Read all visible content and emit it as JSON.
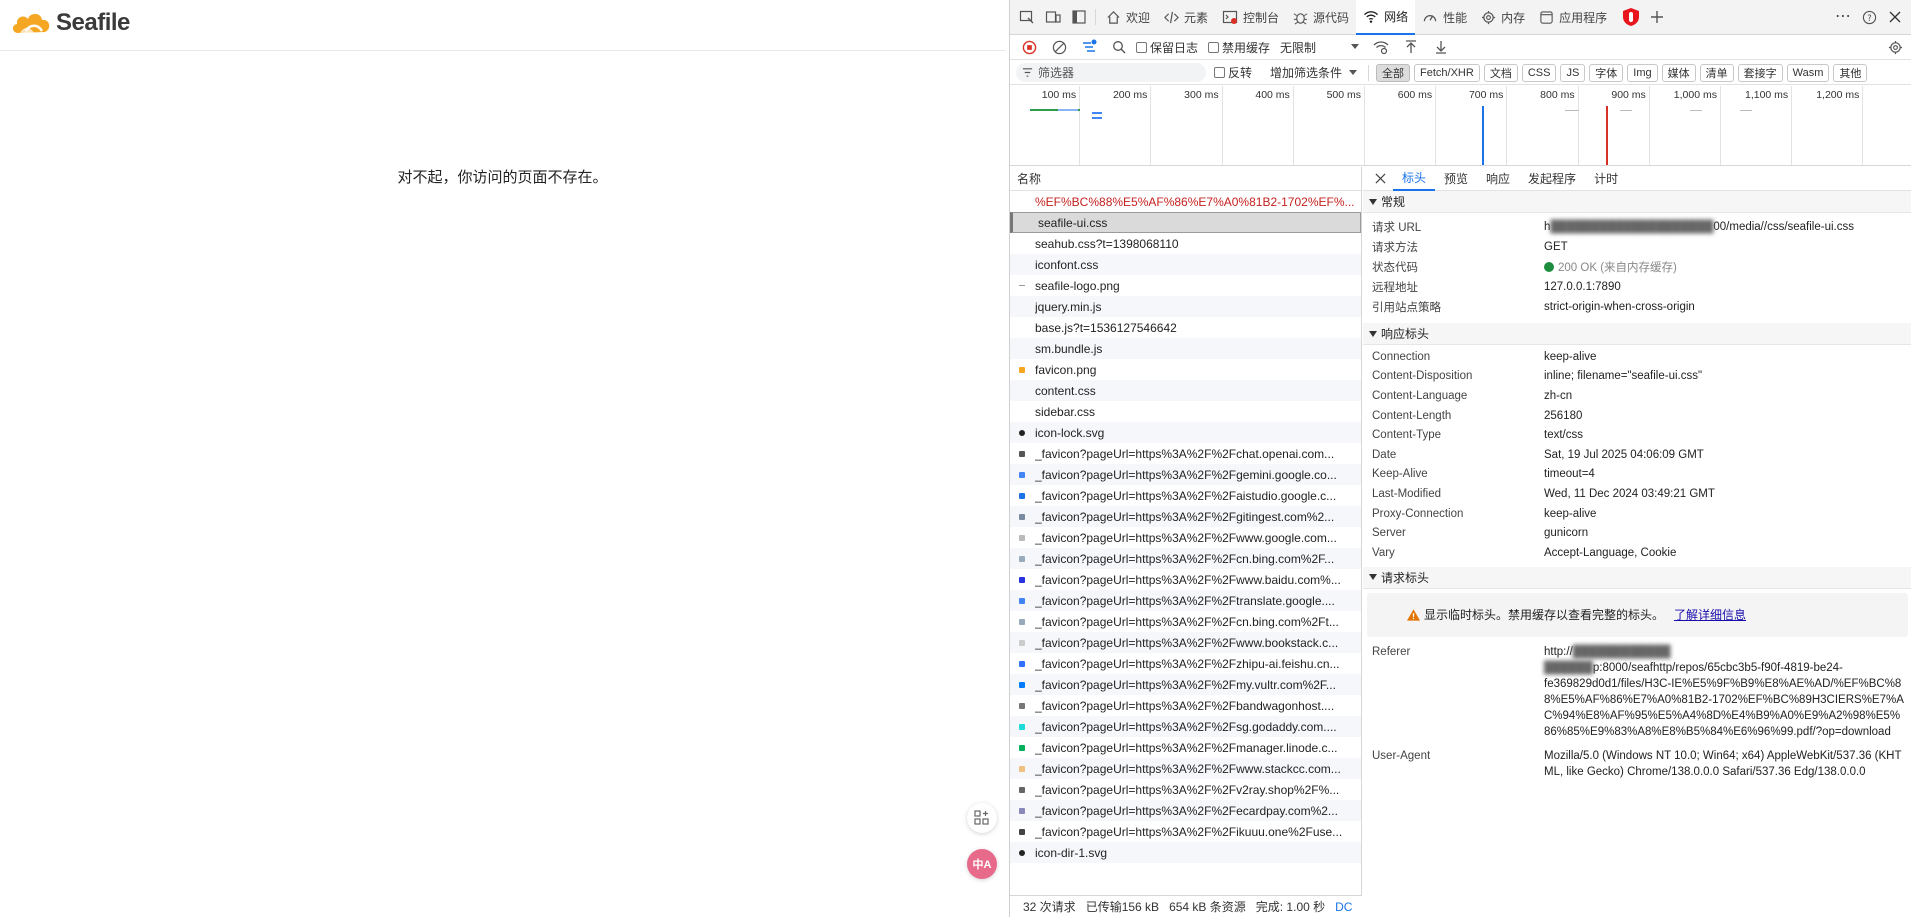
{
  "page": {
    "logo_text_prefix": "Sea",
    "logo_text_suffix": "file",
    "not_found_message": "对不起，你访问的页面不存在。"
  },
  "devtools": {
    "tabs": [
      {
        "label": "欢迎",
        "icon": "home-icon"
      },
      {
        "label": "元素",
        "icon": "code-icon"
      },
      {
        "label": "控制台",
        "icon": "console-icon"
      },
      {
        "label": "源代码",
        "icon": "bug-icon"
      },
      {
        "label": "网络",
        "icon": "wifi-icon",
        "active": true
      },
      {
        "label": "性能",
        "icon": "gauge-icon"
      },
      {
        "label": "内存",
        "icon": "gear-icon"
      },
      {
        "label": "应用程序",
        "icon": "app-icon"
      }
    ],
    "toolbar": {
      "preserve_log": "保留日志",
      "disable_cache": "禁用缓存",
      "throttling": "无限制"
    },
    "filterbar": {
      "filter_placeholder": "筛选器",
      "invert": "反转",
      "more_filters": "增加筛选条件",
      "types": [
        "全部",
        "Fetch/XHR",
        "文档",
        "CSS",
        "JS",
        "字体",
        "Img",
        "媒体",
        "清单",
        "套接字",
        "Wasm",
        "其他"
      ],
      "active_type": "全部"
    },
    "overview": {
      "tick_labels": [
        "100 ms",
        "200 ms",
        "300 ms",
        "400 ms",
        "500 ms",
        "600 ms",
        "700 ms",
        "800 ms",
        "900 ms",
        "1,000 ms",
        "1,100 ms",
        "1,200 ms",
        "1,3"
      ]
    },
    "requests": {
      "header": "名称",
      "rows": [
        {
          "name": "%EF%BC%88%E5%AF%86%E7%A0%81B2-1702%EF%...",
          "icon": "none",
          "error": true
        },
        {
          "name": "seafile-ui.css",
          "icon": "none",
          "selected": true
        },
        {
          "name": "seahub.css?t=1398068110",
          "icon": "none"
        },
        {
          "name": "iconfont.css",
          "icon": "none"
        },
        {
          "name": "seafile-logo.png",
          "icon": "dash-icon"
        },
        {
          "name": "jquery.min.js",
          "icon": "none"
        },
        {
          "name": "base.js?t=1536127546642",
          "icon": "none"
        },
        {
          "name": "sm.bundle.js",
          "icon": "none"
        },
        {
          "name": "favicon.png",
          "icon": "seafile-favicon-icon"
        },
        {
          "name": "content.css",
          "icon": "none"
        },
        {
          "name": "sidebar.css",
          "icon": "none"
        },
        {
          "name": "icon-lock.svg",
          "icon": "lock-icon"
        },
        {
          "name": "_favicon?pageUrl=https%3A%2F%2Fchat.openai.com...",
          "icon": "openai-favicon-icon"
        },
        {
          "name": "_favicon?pageUrl=https%3A%2F%2Fgemini.google.co...",
          "icon": "gemini-favicon-icon"
        },
        {
          "name": "_favicon?pageUrl=https%3A%2F%2Faistudio.google.c...",
          "icon": "aistudio-favicon-icon"
        },
        {
          "name": "_favicon?pageUrl=https%3A%2F%2Fgitingest.com%2...",
          "icon": "gitingest-favicon-icon"
        },
        {
          "name": "_favicon?pageUrl=https%3A%2F%2Fwww.google.com...",
          "icon": "google-favicon-icon"
        },
        {
          "name": "_favicon?pageUrl=https%3A%2F%2Fcn.bing.com%2F...",
          "icon": "bing-favicon-icon"
        },
        {
          "name": "_favicon?pageUrl=https%3A%2F%2Fwww.baidu.com%...",
          "icon": "baidu-favicon-icon"
        },
        {
          "name": "_favicon?pageUrl=https%3A%2F%2Ftranslate.google....",
          "icon": "translate-favicon-icon"
        },
        {
          "name": "_favicon?pageUrl=https%3A%2F%2Fcn.bing.com%2Ft...",
          "icon": "bing-favicon-icon"
        },
        {
          "name": "_favicon?pageUrl=https%3A%2F%2Fwww.bookstack.c...",
          "icon": "bookstack-favicon-icon"
        },
        {
          "name": "_favicon?pageUrl=https%3A%2F%2Fzhipu-ai.feishu.cn...",
          "icon": "feishu-favicon-icon"
        },
        {
          "name": "_favicon?pageUrl=https%3A%2F%2Fmy.vultr.com%2F...",
          "icon": "vultr-favicon-icon"
        },
        {
          "name": "_favicon?pageUrl=https%3A%2F%2Fbandwagonhost....",
          "icon": "bandwagon-favicon-icon"
        },
        {
          "name": "_favicon?pageUrl=https%3A%2F%2Fsg.godaddy.com....",
          "icon": "godaddy-favicon-icon"
        },
        {
          "name": "_favicon?pageUrl=https%3A%2F%2Fmanager.linode.c...",
          "icon": "linode-favicon-icon"
        },
        {
          "name": "_favicon?pageUrl=https%3A%2F%2Fwww.stackcc.com...",
          "icon": "stackcc-favicon-icon"
        },
        {
          "name": "_favicon?pageUrl=https%3A%2F%2Fv2ray.shop%2F%...",
          "icon": "v2ray-favicon-icon"
        },
        {
          "name": "_favicon?pageUrl=https%3A%2F%2Fecardpay.com%2...",
          "icon": "ecardpay-favicon-icon"
        },
        {
          "name": "_favicon?pageUrl=https%3A%2F%2Fikuuu.one%2Fuse...",
          "icon": "ikuuu-favicon-icon"
        },
        {
          "name": "icon-dir-1.svg",
          "icon": "folder-icon"
        }
      ]
    },
    "status_bar": {
      "requests": "32 次请求",
      "transferred": "已传输156 kB",
      "resources": "654 kB 条资源",
      "finish": "完成: 1.00 秒",
      "dcl": "DC"
    },
    "detail": {
      "tabs": [
        "标头",
        "预览",
        "响应",
        "发起程序",
        "计时"
      ],
      "active_tab": "标头",
      "general": {
        "title": "常规",
        "rows": [
          {
            "k": "请求 URL",
            "v_prefix": "h",
            "v_suffix": "00/media//css/seafile-ui.css"
          },
          {
            "k": "请求方法",
            "v": "GET"
          },
          {
            "k": "状态代码",
            "v": "200 OK (来自内存缓存)"
          },
          {
            "k": "远程地址",
            "v": "127.0.0.1:7890"
          },
          {
            "k": "引用站点策略",
            "v": "strict-origin-when-cross-origin"
          }
        ]
      },
      "response_headers": {
        "title": "响应标头",
        "rows": [
          {
            "k": "Connection",
            "v": "keep-alive"
          },
          {
            "k": "Content-Disposition",
            "v": "inline; filename=\"seafile-ui.css\""
          },
          {
            "k": "Content-Language",
            "v": "zh-cn"
          },
          {
            "k": "Content-Length",
            "v": "256180"
          },
          {
            "k": "Content-Type",
            "v": "text/css"
          },
          {
            "k": "Date",
            "v": "Sat, 19 Jul 2025 04:06:09 GMT"
          },
          {
            "k": "Keep-Alive",
            "v": "timeout=4"
          },
          {
            "k": "Last-Modified",
            "v": "Wed, 11 Dec 2024 03:49:21 GMT"
          },
          {
            "k": "Proxy-Connection",
            "v": "keep-alive"
          },
          {
            "k": "Server",
            "v": "gunicorn"
          },
          {
            "k": "Vary",
            "v": "Accept-Language, Cookie"
          }
        ]
      },
      "request_headers": {
        "title": "请求标头",
        "warning": "显示临时标头。禁用缓存以查看完整的标头。",
        "learn_more": "了解详细信息",
        "referer_key": "Referer",
        "referer_line1": "http://",
        "referer_line2_suffix": "p:8000/seafhttp/repos/65cbc3b5-f90f-4819-be24-",
        "referer_rest": "fe369829d0d1/files/H3C-IE%E5%9F%B9%E8%AE%AD/%EF%BC%88%E5%AF%86%E7%A0%81B2-1702%EF%BC%89H3CIERS%E7%AC%94%E8%AF%95%E5%A4%8D%E4%B9%A0%E9%A2%98%E5%86%85%E9%83%A8%E8%B5%84%E6%96%99.pdf/?op=download",
        "ua_key": "User-Agent",
        "ua_value": "Mozilla/5.0 (Windows NT 10.0; Win64; x64) AppleWebKit/537.36 (KHTML, like Gecko) Chrome/138.0.0.0 Safari/537.36 Edg/138.0.0.0"
      }
    }
  }
}
